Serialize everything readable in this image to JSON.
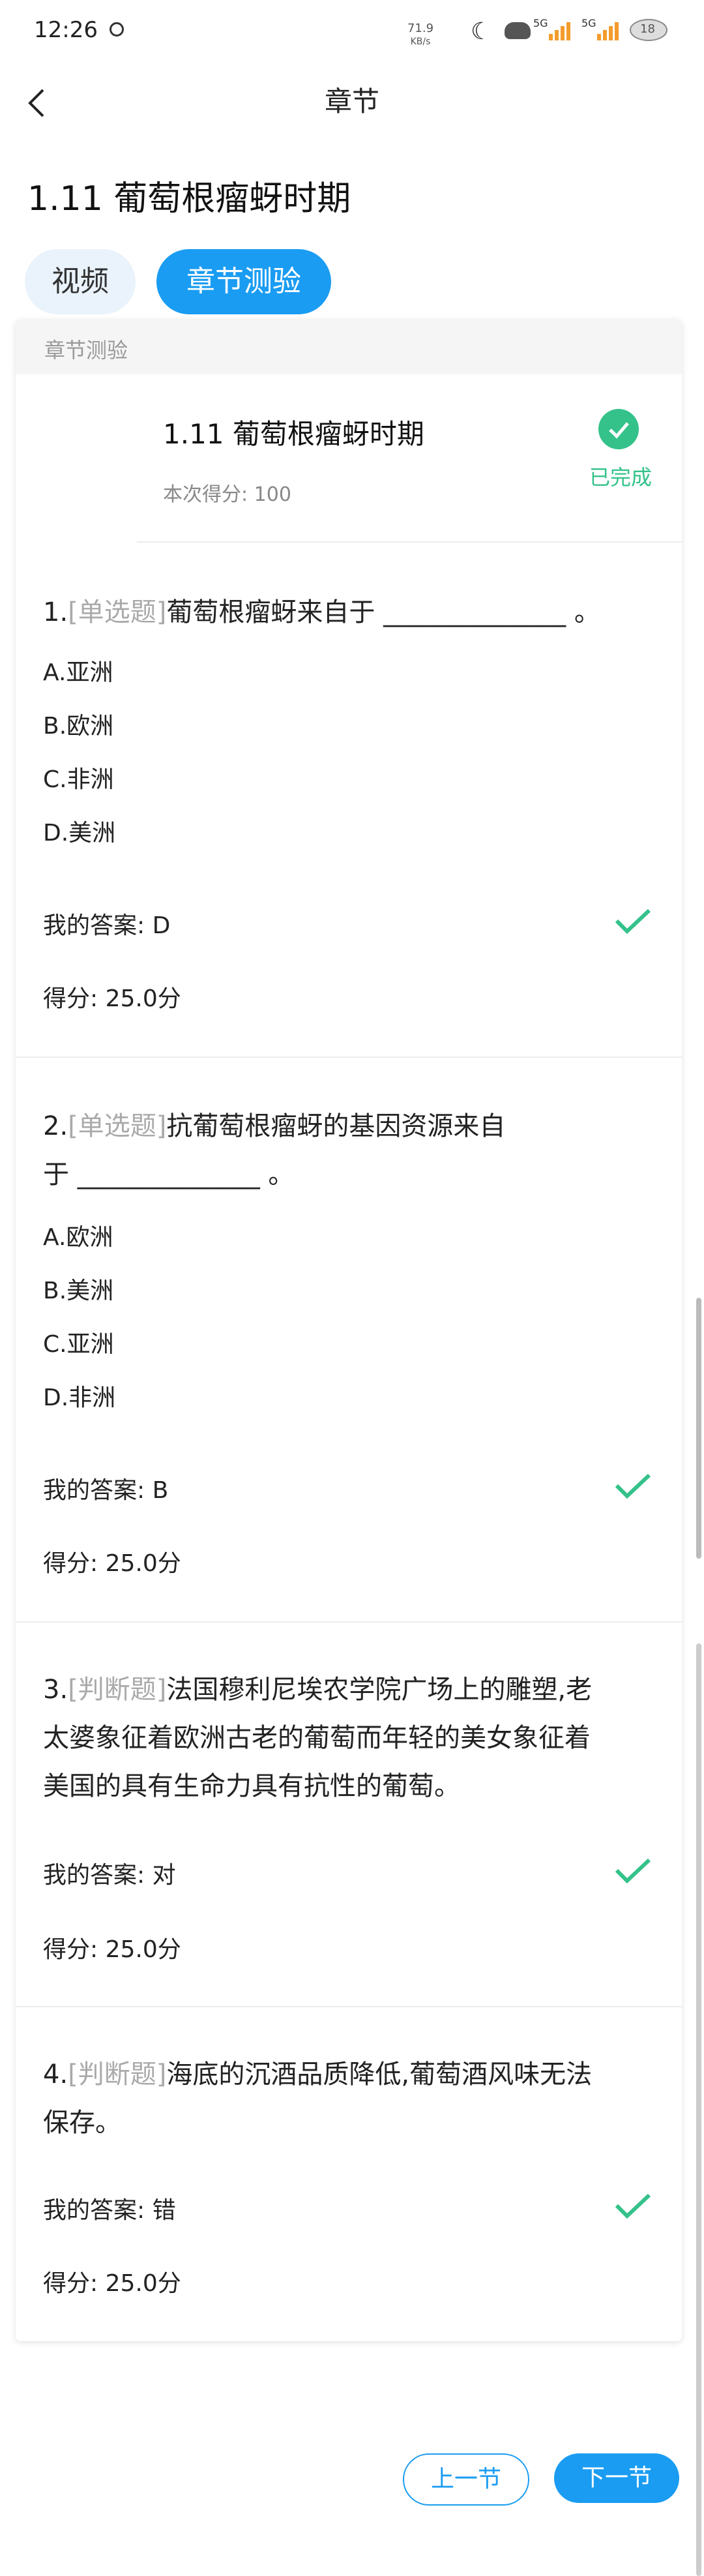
{
  "status_bar": {
    "time": "12:26",
    "net_speed_value": "71.9",
    "net_speed_unit": "KB/s",
    "signal1": "5G",
    "signal2": "5G",
    "battery": "18"
  },
  "header": {
    "title": "章节",
    "back_icon": "chevron-left-icon"
  },
  "page_title": "1.11 葡萄根瘤蚜时期",
  "tabs": [
    {
      "label": "视频",
      "active": false
    },
    {
      "label": "章节测验",
      "active": true
    }
  ],
  "card": {
    "section_label": "章节测验",
    "summary": {
      "title": "1.11 葡萄根瘤蚜时期",
      "score_text": "本次得分: 100",
      "status": "已完成"
    }
  },
  "questions": [
    {
      "number": "1.",
      "type": "[单选题]",
      "line1": "葡萄根瘤蚜来自于 ______________ 。",
      "line2": "",
      "line3": "",
      "options": [
        "A.亚洲",
        "B.欧洲",
        "C.非洲",
        "D.美洲"
      ],
      "answer": "我的答案: D",
      "score": "得分: 25.0分"
    },
    {
      "number": "2.",
      "type": "[单选题]",
      "line1": "抗葡萄根瘤蚜的基因资源来自",
      "line2": "于 ______________ 。",
      "line3": "",
      "options": [
        "A.欧洲",
        "B.美洲",
        "C.亚洲",
        "D.非洲"
      ],
      "answer": "我的答案: B",
      "score": "得分: 25.0分"
    },
    {
      "number": "3.",
      "type": "[判断题]",
      "line1": "法国穆利尼埃农学院广场上的雕塑,老",
      "line2": "太婆象征着欧洲古老的葡萄而年轻的美女象征着",
      "line3": "美国的具有生命力具有抗性的葡萄。",
      "options": [],
      "answer": "我的答案: 对",
      "score": "得分: 25.0分"
    },
    {
      "number": "4.",
      "type": "[判断题]",
      "line1": "海底的沉酒品质降低,葡萄酒风味无法",
      "line2": "保存。",
      "line3": "",
      "options": [],
      "answer": "我的答案: 错",
      "score": "得分: 25.0分"
    }
  ],
  "nav": {
    "prev": "上一节",
    "next": "下一节"
  },
  "colors": {
    "accent": "#1a9cf2",
    "success": "#34c28a"
  }
}
